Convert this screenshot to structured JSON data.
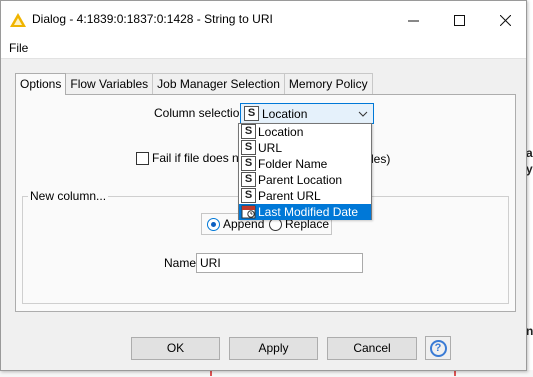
{
  "window": {
    "title": "Dialog - 4:1839:0:1837:0:1428 - String to URI",
    "minimize": "—",
    "maximize": "☐",
    "close": "✕"
  },
  "menu": {
    "file": "File"
  },
  "tabs": [
    {
      "label": "Options",
      "active": true
    },
    {
      "label": "Flow Variables",
      "active": false
    },
    {
      "label": "Job Manager Selection",
      "active": false
    },
    {
      "label": "Memory Policy",
      "active": false
    }
  ],
  "options": {
    "column_selection_label": "Column selection",
    "column_selection_value": "Location",
    "column_type_icon": "S",
    "fail_checkbox_label": "Fail if file does not",
    "fail_checkbox_label_tail": "les)",
    "fail_checked": false,
    "new_column_group_title": "New column...",
    "append_label": "Append",
    "replace_label": "Replace",
    "append_selected": true,
    "name_label": "Name",
    "name_value": "URI"
  },
  "dropdown": {
    "items": [
      {
        "label": "Location",
        "icon": "S",
        "type": "string"
      },
      {
        "label": "URL",
        "icon": "S",
        "type": "string"
      },
      {
        "label": "Folder Name",
        "icon": "S",
        "type": "string"
      },
      {
        "label": "Parent Location",
        "icon": "S",
        "type": "string"
      },
      {
        "label": "Parent URL",
        "icon": "S",
        "type": "string"
      },
      {
        "label": "Last Modified Date",
        "icon": "calendar-icon",
        "type": "date",
        "selected": true
      }
    ]
  },
  "buttons": {
    "ok": "OK",
    "apply": "Apply",
    "cancel": "Cancel",
    "help": "?"
  },
  "background": {
    "right_glyph_1": "a",
    "right_glyph_2": "y",
    "right_glyph_3": "n"
  },
  "colors": {
    "accent": "#0078d7",
    "title_icon": "#f0b400",
    "window_bg": "#f0f0f0",
    "panel_bg": "#fafafa"
  }
}
